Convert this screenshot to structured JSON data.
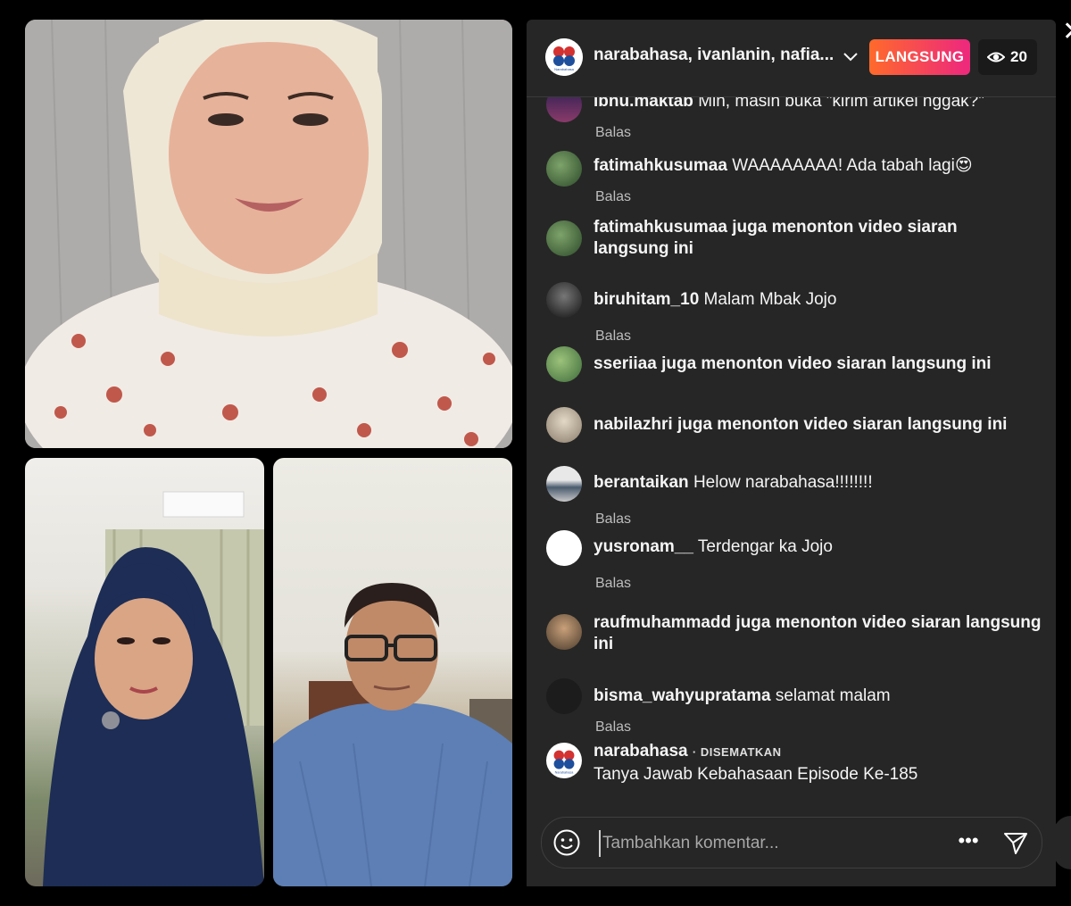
{
  "stream": {
    "title": "narabahasa, ivanlanin, nafia...",
    "live_label": "LANGSUNG",
    "viewer_count": "20"
  },
  "comments": [
    {
      "user": "ibnu.maktab",
      "text": "Min, masih buka \"kirim artikel nggak?\"",
      "reply": "Balas"
    },
    {
      "user": "fatimahkusumaa",
      "text": "WAAAAAAAA! Ada tabah lagi😍",
      "reply": "Balas"
    },
    {
      "user": "fatimahkusumaa",
      "text": "juga menonton video siaran langsung ini"
    },
    {
      "user": "biruhitam_10",
      "text": "Malam Mbak Jojo",
      "reply": "Balas"
    },
    {
      "user": "sseriiaa",
      "text": "juga menonton video siaran langsung ini"
    },
    {
      "user": "nabilazhri",
      "text": "juga menonton video siaran langsung ini"
    },
    {
      "user": "berantaikan",
      "text": "Helow narabahasa!!!!!!!!",
      "reply": "Balas"
    },
    {
      "user": "yusronam__",
      "text": "Terdengar ka Jojo",
      "reply": "Balas"
    },
    {
      "user": "raufmuhammadd",
      "text": "juga menonton video siaran langsung ini"
    },
    {
      "user": "bisma_wahyupratama",
      "text": "selamat malam",
      "reply": "Balas"
    }
  ],
  "pinned": {
    "user": "narabahasa",
    "tag": "· DISEMATKAN",
    "text": "Tanya Jawab Kebahasaan Episode Ke-185"
  },
  "logo_text": "Narabahasa",
  "input": {
    "placeholder": "Tambahkan komentar..."
  },
  "icons": {
    "close": "close-icon",
    "chevron": "chevron-down-icon",
    "eye": "eye-icon",
    "emoji": "emoji-icon",
    "more": "more-icon",
    "send": "send-icon"
  },
  "colors": {
    "live_gradient_start": "#ff6a2b",
    "live_gradient_end": "#ee2a7b",
    "panel_bg": "#262626"
  }
}
